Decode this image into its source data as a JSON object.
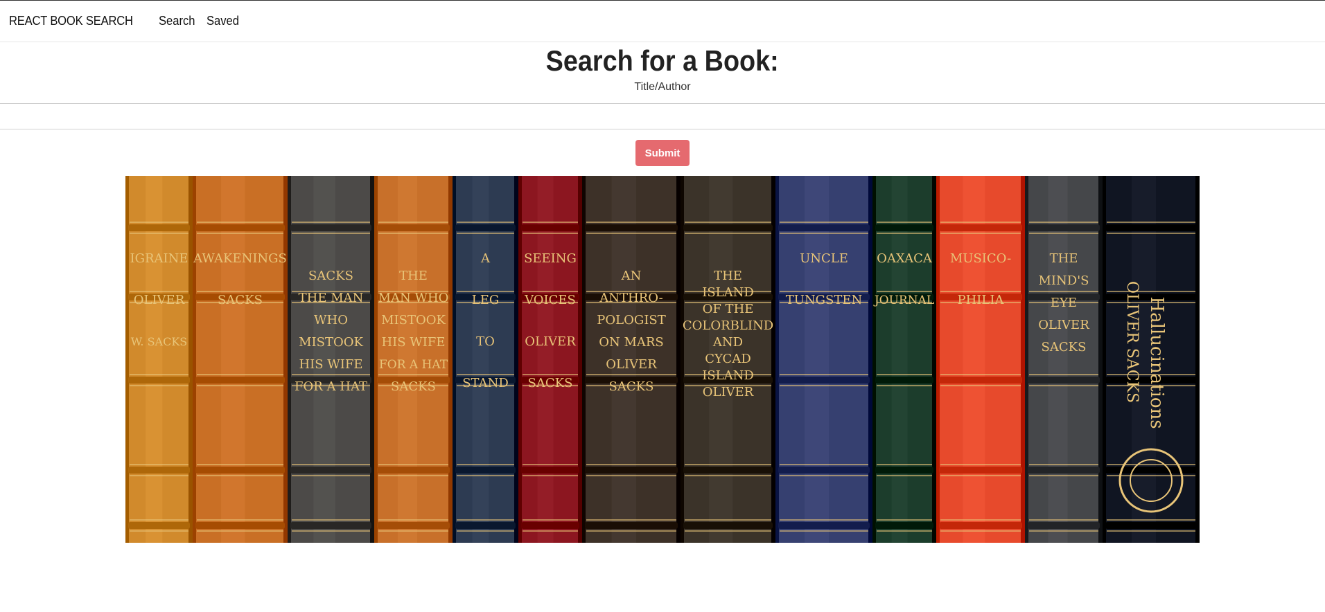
{
  "nav": {
    "brand": "REACT BOOK SEARCH",
    "links": [
      "Search",
      "Saved"
    ]
  },
  "search": {
    "title": "Search for a Book:",
    "label": "Title/Author",
    "value": "",
    "placeholder": "",
    "submit_label": "Submit"
  },
  "banner": {
    "spines": [
      {
        "color": "#d18a2c",
        "lines": [
          "IGRAINE",
          "OLIVER",
          "W. SACKS"
        ]
      },
      {
        "color": "#c96f25",
        "lines": [
          "AWAKENINGS",
          "SACKS"
        ]
      },
      {
        "color": "#4c4a48",
        "lines": [
          "SACKS",
          "THE MAN",
          "WHO",
          "MISTOOK",
          "HIS WIFE",
          "FOR A HAT"
        ]
      },
      {
        "color": "#c8702a",
        "lines": [
          "THE",
          "MAN WHO",
          "MISTOOK",
          "HIS WIFE",
          "FOR A HAT",
          "SACKS"
        ]
      },
      {
        "color": "#2d3b52",
        "lines": [
          "A",
          "LEG",
          "TO",
          "STAND"
        ]
      },
      {
        "color": "#8c1620",
        "lines": [
          "SEEING",
          "VOICES",
          "OLIVER",
          "SACKS"
        ]
      },
      {
        "color": "#3d3128",
        "lines": [
          "AN",
          "ANTHRO-",
          "POLOGIST",
          "ON MARS",
          "OLIVER",
          "SACKS"
        ]
      },
      {
        "color": "#3b3329",
        "lines": [
          "THE",
          "ISLAND",
          "OF THE",
          "COLORBLIND",
          "AND",
          "CYCAD",
          "ISLAND",
          "OLIVER"
        ]
      },
      {
        "color": "#364070",
        "lines": [
          "UNCLE",
          "TUNGSTEN"
        ]
      },
      {
        "color": "#1c3d2c",
        "lines": [
          "OAXACA",
          "JOURNAL"
        ]
      },
      {
        "color": "#e74a2c",
        "lines": [
          "MUSICO-",
          "PHILIA"
        ]
      },
      {
        "color": "#45474a",
        "lines": [
          "THE",
          "MIND'S",
          "EYE",
          "OLIVER",
          "SACKS"
        ]
      },
      {
        "color": "#101522",
        "lines": [
          "Hallucinations",
          "OLIVER SACKS"
        ]
      }
    ],
    "accent": "#e8c478"
  }
}
